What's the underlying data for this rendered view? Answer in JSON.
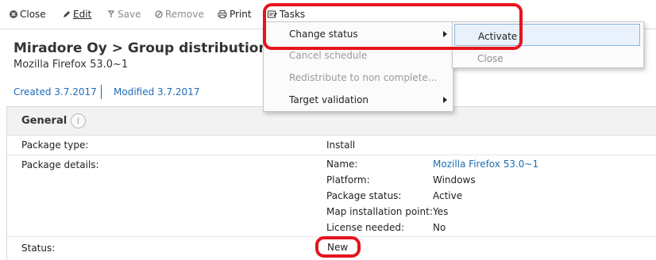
{
  "toolbar": {
    "close_label": "Close",
    "edit_label": "Edit",
    "save_label": "Save",
    "remove_label": "Remove",
    "print_label": "Print",
    "tasks_label": "Tasks"
  },
  "header": {
    "title": "Miradore Oy > Group distribution",
    "subtitle": "Mozilla Firefox 53.0~1",
    "created": "Created 3.7.2017",
    "modified": "Modified 3.7.2017"
  },
  "panel": {
    "title": "General",
    "info_icon": "i",
    "package_type_label": "Package type:",
    "package_type_value": "Install",
    "package_details_label": "Package details:",
    "details": [
      {
        "label": "Name:",
        "value": "Mozilla Firefox 53.0~1"
      },
      {
        "label": "Platform:",
        "value": "Windows"
      },
      {
        "label": "Package status:",
        "value": "Active"
      },
      {
        "label": "Map installation point:",
        "value": "Yes"
      },
      {
        "label": "License needed:",
        "value": "No"
      }
    ],
    "status_label": "Status:",
    "status_value": "New"
  },
  "tasks_menu": {
    "items": [
      {
        "label": "Change status",
        "enabled": true,
        "submenu": true
      },
      {
        "label": "Cancel schedule",
        "enabled": false
      },
      {
        "label": "Redistribute to non complete...",
        "enabled": false
      },
      {
        "label": "Target validation",
        "enabled": true,
        "submenu": true
      }
    ]
  },
  "status_submenu": {
    "items": [
      {
        "label": "Activate",
        "highlighted": true
      },
      {
        "label": "Close",
        "enabled": false
      }
    ]
  },
  "colors": {
    "link": "#1f6cb5",
    "highlight_annotation": "#e5141d",
    "menu_highlight": "#e8f1fc"
  },
  "icons": {
    "close": "close-circle-icon",
    "edit": "pencil-icon",
    "save": "save-icon",
    "remove": "remove-circle-icon",
    "print": "printer-icon",
    "tasks": "tasks-icon"
  }
}
